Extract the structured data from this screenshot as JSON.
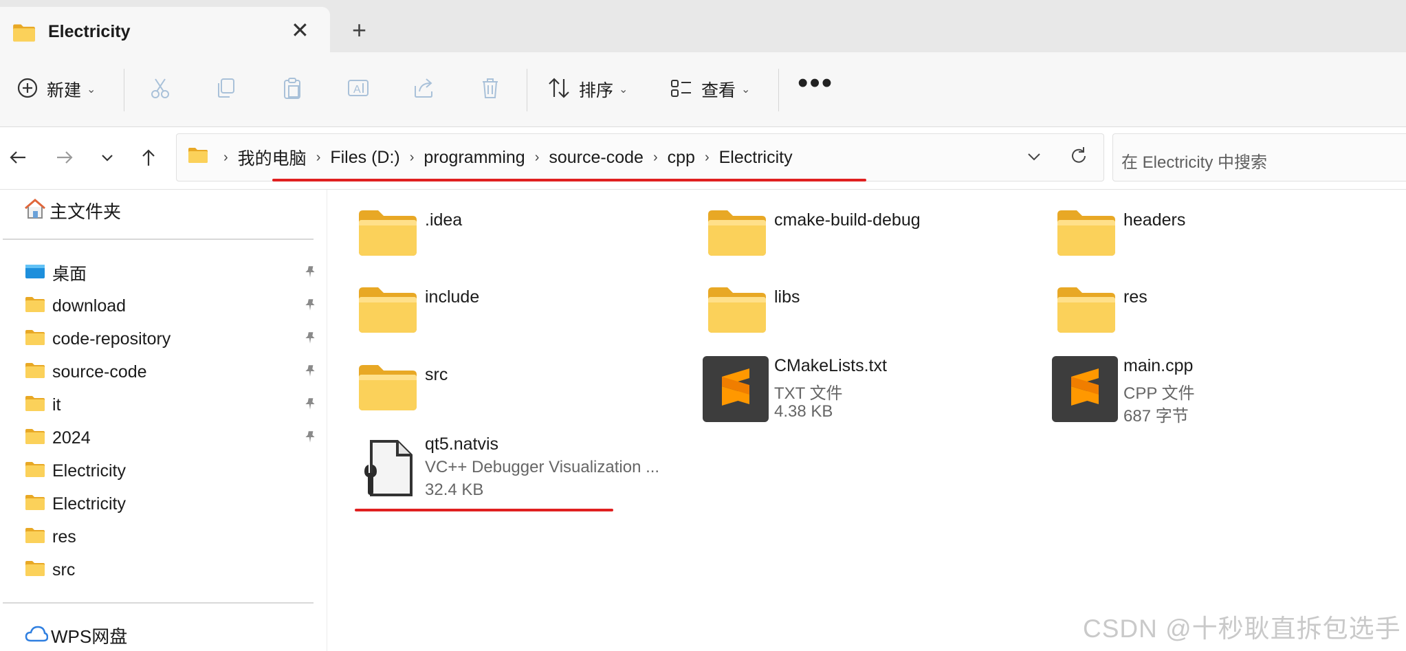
{
  "window": {
    "tab_title": "Electricity",
    "new_tab_symbol": "+",
    "close_symbol": "✕"
  },
  "toolbar": {
    "new_label": "新建",
    "sort_label": "排序",
    "view_label": "查看",
    "more_label": "•••"
  },
  "address": {
    "crumbs": [
      "我的电脑",
      "Files (D:)",
      "programming",
      "source-code",
      "cpp",
      "Electricity"
    ],
    "search_placeholder": "在 Electricity 中搜索"
  },
  "sidebar": {
    "home_label": "主文件夹",
    "quick_access": [
      {
        "label": "桌面",
        "pinned": true,
        "icon": "desktop-icon"
      },
      {
        "label": "download",
        "pinned": true,
        "icon": "folder-icon"
      },
      {
        "label": "code-repository",
        "pinned": true,
        "icon": "folder-icon"
      },
      {
        "label": "source-code",
        "pinned": true,
        "icon": "folder-icon"
      },
      {
        "label": "it",
        "pinned": true,
        "icon": "folder-icon"
      },
      {
        "label": "2024",
        "pinned": true,
        "icon": "folder-icon"
      },
      {
        "label": "Electricity",
        "pinned": false,
        "icon": "folder-icon"
      },
      {
        "label": "Electricity",
        "pinned": false,
        "icon": "folder-icon"
      },
      {
        "label": "res",
        "pinned": false,
        "icon": "folder-icon"
      },
      {
        "label": "src",
        "pinned": false,
        "icon": "folder-icon"
      }
    ],
    "cloud_label": "WPS网盘"
  },
  "files": [
    {
      "name": ".idea",
      "kind": "folder"
    },
    {
      "name": "cmake-build-debug",
      "kind": "folder"
    },
    {
      "name": "headers",
      "kind": "folder"
    },
    {
      "name": "include",
      "kind": "folder"
    },
    {
      "name": "libs",
      "kind": "folder"
    },
    {
      "name": "res",
      "kind": "folder"
    },
    {
      "name": "src",
      "kind": "folder"
    },
    {
      "name": "CMakeLists.txt",
      "kind": "sublime-file",
      "type": "TXT 文件",
      "size": "4.38 KB"
    },
    {
      "name": "main.cpp",
      "kind": "sublime-file",
      "type": "CPP 文件",
      "size": "687 字节"
    },
    {
      "name": "qt5.natvis",
      "kind": "natvis-file",
      "type": "VC++ Debugger Visualization ...",
      "size": "32.4 KB"
    }
  ],
  "watermark": "CSDN @十秒耿直拆包选手",
  "colors": {
    "folder": "#f6c445",
    "annotation_red": "#e02020",
    "sublime_bg": "#3d3d3d",
    "sublime_orange": "#ff9800"
  }
}
